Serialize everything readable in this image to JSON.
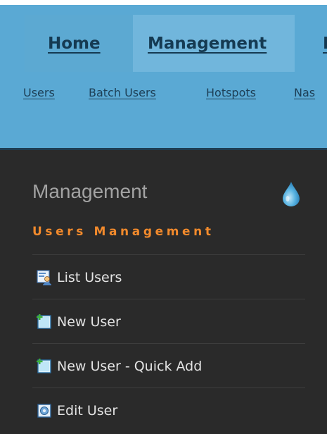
{
  "topnav": {
    "tabs": [
      {
        "label": "Home"
      },
      {
        "label": "Management"
      },
      {
        "label": "R"
      }
    ]
  },
  "subnav": {
    "links": [
      {
        "label": "Users"
      },
      {
        "label": "Batch Users"
      },
      {
        "label": "Hotspots"
      },
      {
        "label": "Nas"
      }
    ]
  },
  "sidebar": {
    "title": "Management",
    "section_title": "Users Management",
    "items": [
      {
        "label": "List Users",
        "icon": "list-users-icon"
      },
      {
        "label": "New User",
        "icon": "new-user-icon"
      },
      {
        "label": "New User - Quick Add",
        "icon": "new-user-quick-add-icon"
      },
      {
        "label": "Edit User",
        "icon": "edit-user-icon"
      }
    ]
  },
  "colors": {
    "header_bg": "#5aa9d4",
    "active_tab_bg": "#71b6dc",
    "sidebar_bg": "#2a2a2a",
    "section_accent": "#f28a2c"
  }
}
